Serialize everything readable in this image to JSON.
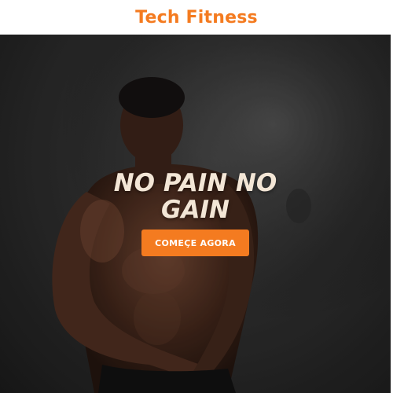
{
  "header": {
    "brand": "Tech Fitness",
    "brand_color": "#f47b20"
  },
  "hero": {
    "background_image": "athlete-photo",
    "headline": "NO PAIN NO GAIN",
    "cta_label": "COMEÇE AGORA",
    "cta_color": "#f47b20"
  }
}
